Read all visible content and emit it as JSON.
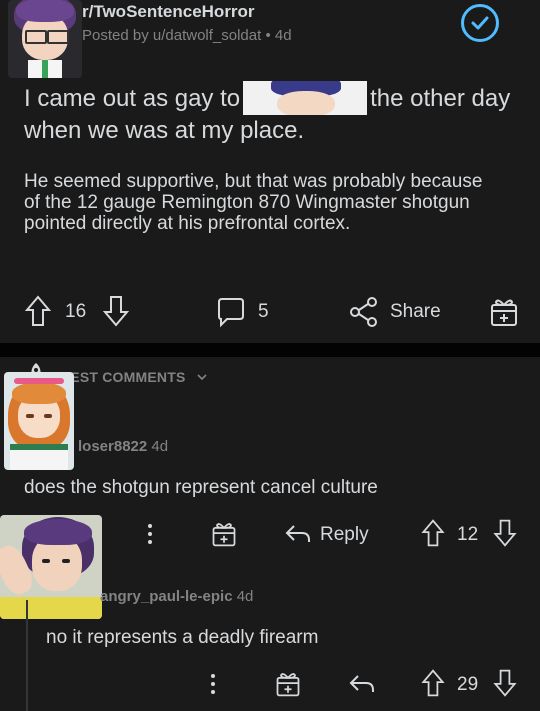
{
  "post": {
    "subreddit": "r/TwoSentenceHorror",
    "posted_by": "Posted by u/datwolf_soldat",
    "age": "4d",
    "title_part1": "I came out as gay to",
    "title_part2": "the other day when we was at my place.",
    "body": "He seemed supportive, but that was probably because of the 12 gauge Remington 870 Wingmaster shotgun pointed directly at his prefrontal cortex.",
    "upvotes": "16",
    "comments": "5",
    "share_label": "Share"
  },
  "comments_section": {
    "sort_label": "BEST COMMENTS",
    "comments": [
      {
        "username": "loser8822",
        "age": "4d",
        "text": "does the shotgun represent cancel culture",
        "reply_label": "Reply",
        "score": "12"
      },
      {
        "username": "angry_paul-le-epic",
        "age": "4d",
        "text": "no it represents a deadly firearm",
        "score": "29"
      }
    ]
  },
  "colors": {
    "background": "#1a1a1b",
    "separator": "#030303",
    "text": "#d7dadc",
    "meta": "#818384",
    "accent": "#4fbcff"
  },
  "icons": [
    "upvote-icon",
    "downvote-icon",
    "comment-icon",
    "share-icon",
    "award-icon",
    "more-icon",
    "reply-icon",
    "verified-icon",
    "chevron-down-icon"
  ]
}
